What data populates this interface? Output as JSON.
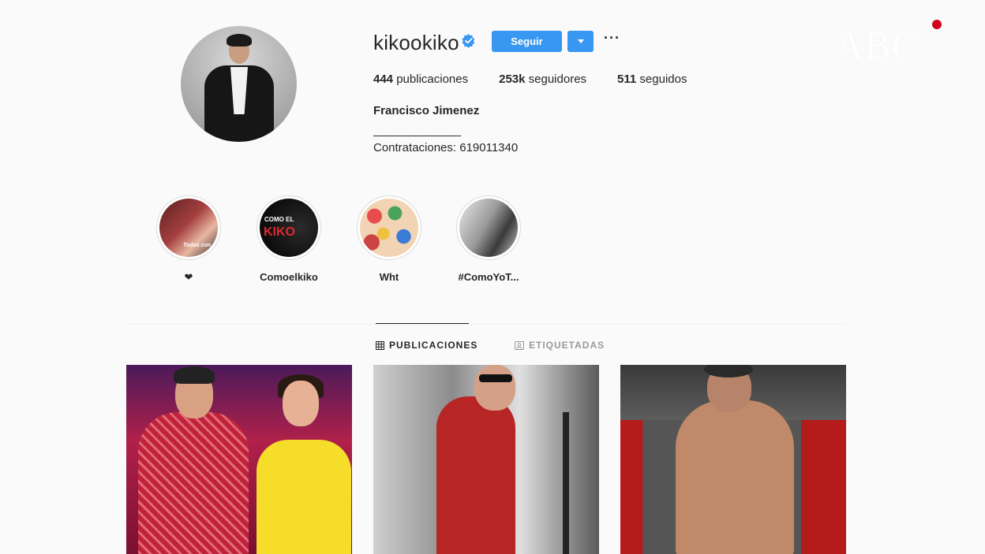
{
  "profile": {
    "username": "kikookiko",
    "verified": true,
    "follow_label": "Seguir",
    "more_label": "···",
    "stats": {
      "posts_count": "444",
      "posts_label": "publicaciones",
      "followers_count": "253k",
      "followers_label": "seguidores",
      "following_count": "511",
      "following_label": "seguidos"
    },
    "full_name": "Francisco Jimenez",
    "bio_divider": "_______________",
    "bio_contract": "Contrataciones: 619011340"
  },
  "watermark": {
    "text": "ABC",
    "dot_color": "#d0021b"
  },
  "highlights": [
    {
      "label": "❤",
      "overlay_text": "Todos con"
    },
    {
      "label": "Comoelkiko",
      "overlay_small": "COMO EL",
      "overlay_big": "KIKO"
    },
    {
      "label": "Wht"
    },
    {
      "label": "#ComoYoT..."
    }
  ],
  "tabs": [
    {
      "label": "PUBLICACIONES",
      "icon": "grid-icon",
      "active": true
    },
    {
      "label": "ETIQUETADAS",
      "icon": "tag-icon",
      "active": false
    }
  ],
  "colors": {
    "accent": "#3897f0",
    "text": "#262626",
    "muted": "#999999",
    "background": "#fafafa"
  }
}
